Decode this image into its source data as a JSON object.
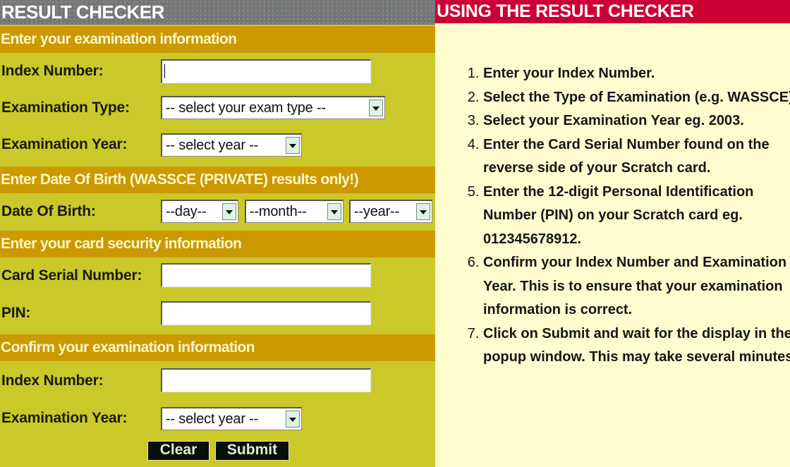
{
  "left_panel": {
    "title": "RESULT CHECKER",
    "sections": {
      "exam_info": "Enter your examination information",
      "dob": "Enter Date Of Birth (WASSCE (PRIVATE) results only!)",
      "card": "Enter your card security information",
      "confirm": "Confirm your examination information"
    },
    "fields": {
      "index_number": {
        "label": "Index Number:",
        "value": ""
      },
      "exam_type": {
        "label": "Examination Type:",
        "selected": "-- select your exam type --"
      },
      "exam_year": {
        "label": "Examination Year:",
        "selected": "-- select year --"
      },
      "dob": {
        "label": "Date Of Birth:",
        "day": "--day--",
        "month": "--month--",
        "year": "--year--"
      },
      "card_serial": {
        "label": "Card Serial Number:",
        "value": ""
      },
      "pin": {
        "label": "PIN:",
        "value": ""
      },
      "confirm_index": {
        "label": "Index Number:",
        "value": ""
      },
      "confirm_year": {
        "label": "Examination Year:",
        "selected": "-- select year --"
      }
    },
    "buttons": {
      "clear": "Clear",
      "submit": "Submit"
    },
    "icons": {
      "dropdown": "chevron-down-icon"
    }
  },
  "right_panel": {
    "title": "USING THE RESULT CHECKER",
    "steps": [
      "Enter your Index Number.",
      "Select the Type of Examination (e.g. WASSCE).",
      "Select your Examination Year eg. 2003.",
      "Enter the Card Serial Number found on the reverse side of your Scratch card.",
      "Enter the 12-digit Personal Identification Number (PIN) on your Scratch card eg. 012345678912.",
      "Confirm your Index Number and Examination Year. This is to ensure that your examination information is correct.",
      "Click on Submit and wait for the display in the popup window. This may take several minutes."
    ]
  },
  "colors": {
    "form_bg": "#cbc929",
    "section_bar": "#cc9900",
    "header_gray": "#76787a",
    "header_red": "#cc0033",
    "instructions_bg": "#fffdcf",
    "button_bg": "#0b0f0c"
  }
}
